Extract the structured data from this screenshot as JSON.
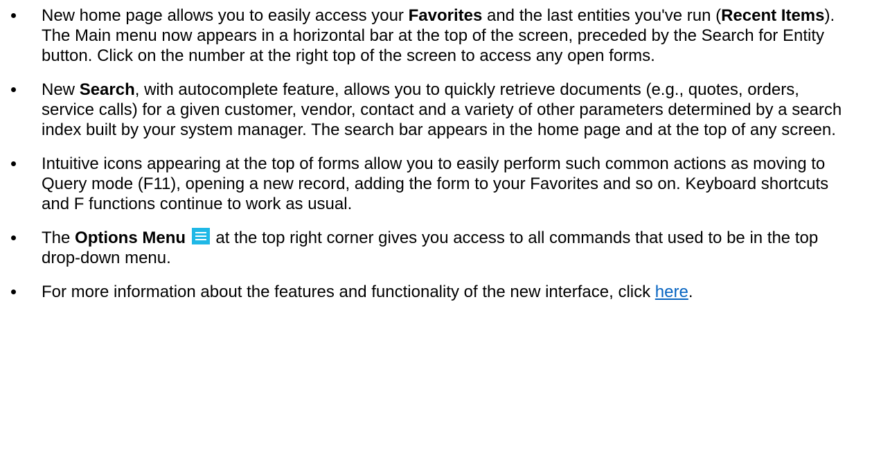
{
  "bullets": [
    {
      "a": "New home page allows you to easily access your ",
      "b_bold": "Favorites",
      "c": " and the last entities you've run (",
      "d_bold": "Recent Items",
      "e": "). The Main menu now appears in a horizontal bar at the top of the screen, preceded by the Search for Entity button. Click on the number at the right top of the screen to access any open forms."
    },
    {
      "a": "New ",
      "b_bold": "Search",
      "c": ", with autocomplete feature, allows you to quickly retrieve documents (e.g., quotes, orders, service calls) for a given customer, vendor, contact and a variety of other parameters determined by a search index built by your system manager. The search bar appears in the home page and at the top of any screen."
    },
    {
      "a": "Intuitive icons appearing at the top of forms allow you to easily perform such common actions as moving to Query mode (F11), opening a new record, adding the form to your Favorites and so on. Keyboard shortcuts and F functions continue to work as usual."
    },
    {
      "a": "The ",
      "b_bold": "Options Menu",
      "icon": "hamburger-menu-icon",
      "c": " at the top right corner gives you access to all commands that used to be in the top drop-down menu."
    },
    {
      "a": "For more information about the features and functionality of the new interface, click ",
      "link": "here",
      "c": "."
    }
  ],
  "colors": {
    "text": "#000000",
    "link": "#0563c1",
    "icon_bg": "#1fb8e6"
  }
}
